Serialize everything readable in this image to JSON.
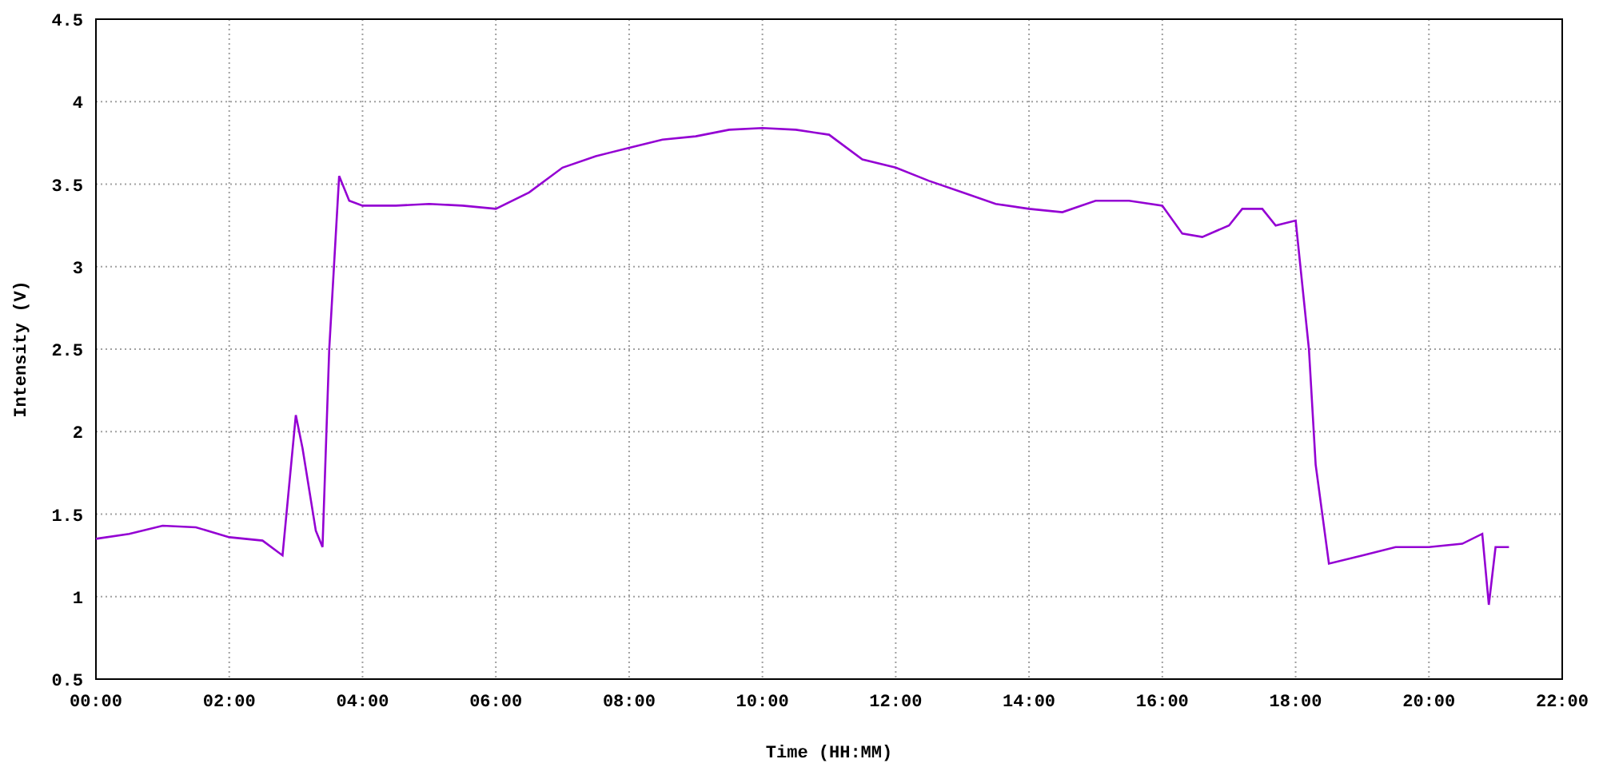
{
  "chart": {
    "chart_data": {
      "type": "line",
      "xlabel": "Time (HH:MM)",
      "ylabel": "Intensity (V)",
      "x": [
        0,
        0.5,
        1,
        1.5,
        2,
        2.5,
        2.8,
        3.0,
        3.1,
        3.3,
        3.4,
        3.5,
        3.65,
        3.8,
        4,
        4.5,
        5,
        5.5,
        6,
        6.5,
        7,
        7.5,
        8,
        8.5,
        9,
        9.5,
        10,
        10.5,
        11,
        11.5,
        12,
        12.5,
        13,
        13.5,
        14,
        14.5,
        15,
        15.5,
        16,
        16.3,
        16.6,
        17,
        17.2,
        17.5,
        17.7,
        18,
        18.2,
        18.3,
        18.5,
        19,
        19.5,
        20,
        20.5,
        20.8,
        20.9,
        21,
        21.2
      ],
      "grid": true,
      "series": [
        {
          "color": "#9400d3",
          "values": [
            1.35,
            1.38,
            1.43,
            1.42,
            1.36,
            1.34,
            1.25,
            2.1,
            1.9,
            1.4,
            1.3,
            2.5,
            3.55,
            3.4,
            3.37,
            3.37,
            3.38,
            3.37,
            3.35,
            3.45,
            3.6,
            3.67,
            3.72,
            3.77,
            3.79,
            3.83,
            3.84,
            3.83,
            3.8,
            3.65,
            3.6,
            3.52,
            3.45,
            3.38,
            3.35,
            3.33,
            3.4,
            3.4,
            3.37,
            3.2,
            3.18,
            3.25,
            3.35,
            3.35,
            3.25,
            3.28,
            2.5,
            1.8,
            1.2,
            1.25,
            1.3,
            1.3,
            1.32,
            1.38,
            0.95,
            1.3,
            1.3
          ]
        }
      ],
      "xlim": [
        0,
        22
      ],
      "ylim": [
        0.5,
        4.5
      ],
      "xticks": [
        {
          "value": 0,
          "label": "00:00"
        },
        {
          "value": 2,
          "label": "02:00"
        },
        {
          "value": 4,
          "label": "04:00"
        },
        {
          "value": 6,
          "label": "06:00"
        },
        {
          "value": 8,
          "label": "08:00"
        },
        {
          "value": 10,
          "label": "10:00"
        },
        {
          "value": 12,
          "label": "12:00"
        },
        {
          "value": 14,
          "label": "14:00"
        },
        {
          "value": 16,
          "label": "16:00"
        },
        {
          "value": 18,
          "label": "18:00"
        },
        {
          "value": 20,
          "label": "20:00"
        },
        {
          "value": 22,
          "label": "22:00"
        }
      ],
      "yticks": [
        {
          "value": 0.5,
          "label": "0.5"
        },
        {
          "value": 1,
          "label": "1"
        },
        {
          "value": 1.5,
          "label": "1.5"
        },
        {
          "value": 2,
          "label": "2"
        },
        {
          "value": 2.5,
          "label": "2.5"
        },
        {
          "value": 3,
          "label": "3"
        },
        {
          "value": 3.5,
          "label": "3.5"
        },
        {
          "value": 4,
          "label": "4"
        },
        {
          "value": 4.5,
          "label": "4.5"
        }
      ]
    }
  }
}
